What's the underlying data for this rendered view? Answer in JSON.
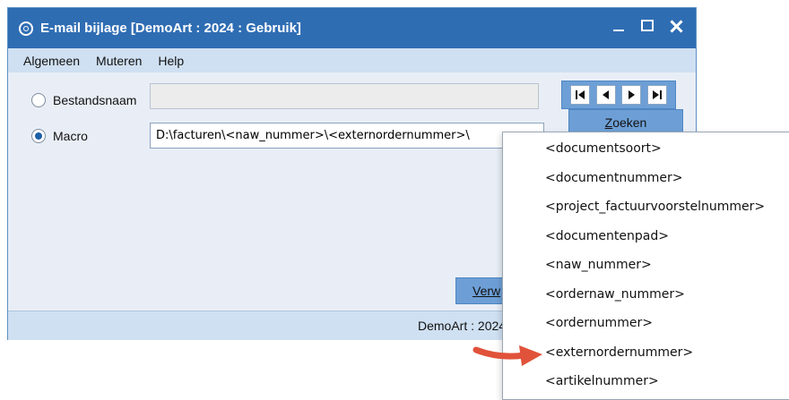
{
  "window": {
    "title": "E-mail bijlage  [DemoArt : 2024 : Gebruik]",
    "colors": {
      "titlebar": "#2f6db3",
      "menubar": "#cfe0f2",
      "accent": "#6d9fd6"
    }
  },
  "menu": {
    "items": [
      "Algemeen",
      "Muteren",
      "Help"
    ]
  },
  "form": {
    "bestandsnaam_label": "Bestandsnaam",
    "bestandsnaam_value": "",
    "macro_label": "Macro",
    "macro_value": "D:\\facturen\\<naw_nummer>\\<externordernummer>\\",
    "selected": "Macro"
  },
  "nav": {
    "icons": [
      "first-record-icon",
      "previous-record-icon",
      "next-record-icon",
      "last-record-icon"
    ]
  },
  "buttons": {
    "zoeken_pre": "",
    "zoeken_key": "Z",
    "zoeken_rest": "oeken",
    "verw_key": "",
    "verw_label": "Verw"
  },
  "status": {
    "text": "DemoArt : 2024"
  },
  "dropdown": {
    "items": [
      "<documentsoort>",
      "<documentnummer>",
      "<project_factuurvoorstelnummer>",
      "<documentenpad>",
      "<naw_nummer>",
      "<ordernaw_nummer>",
      "<ordernummer>",
      "<externordernummer>",
      "<artikelnummer>"
    ],
    "highlighted": "<externordernummer>"
  },
  "annotation": {
    "arrow_color": "#e0533a"
  }
}
